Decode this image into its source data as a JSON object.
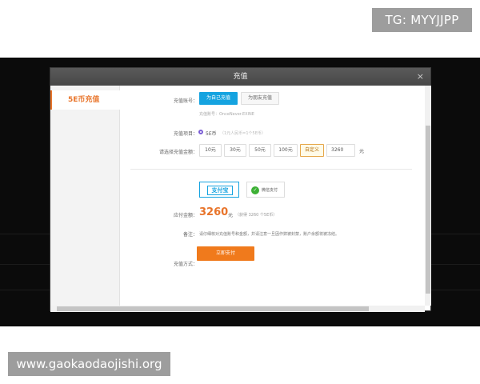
{
  "watermarks": {
    "top": "TG: MYYJJPP",
    "bottom": "www.gaokaodaojishi.org"
  },
  "dialog": {
    "title": "充值",
    "close": "×",
    "sidebar": {
      "items": [
        {
          "label": "5E币充值"
        }
      ]
    },
    "account": {
      "label": "充值账号：",
      "self_label": "为自己充值",
      "friend_label": "为朋友充值",
      "account_name": "充值账号：OnceNever.EXINE"
    },
    "item": {
      "label": "充值项目：",
      "option": "5E币",
      "rate": "（1元人民币=1个5E币）"
    },
    "amount": {
      "label": "请选择充值金额：",
      "options": [
        "10元",
        "30元",
        "50元",
        "100元"
      ],
      "custom_label": "自定义",
      "custom_value": "3260",
      "unit": "元"
    },
    "payment": {
      "label": "充值方式：",
      "alipay": "支付宝",
      "wechat": "微信支付"
    },
    "total": {
      "label": "应付金额：",
      "value": "3260",
      "unit": "元",
      "note": "（获得 3260 个5E币）"
    },
    "remark": {
      "label": "备注：",
      "text": "请仔细核对充值账号和金额，并请注意一旦因作弊被封禁，账户余额将被冻结。"
    },
    "submit_label": "立即支付"
  },
  "colors": {
    "accent": "#e8742a",
    "primary": "#15a3e0",
    "pay_button": "#f07a1c",
    "wechat": "#3cb034"
  }
}
